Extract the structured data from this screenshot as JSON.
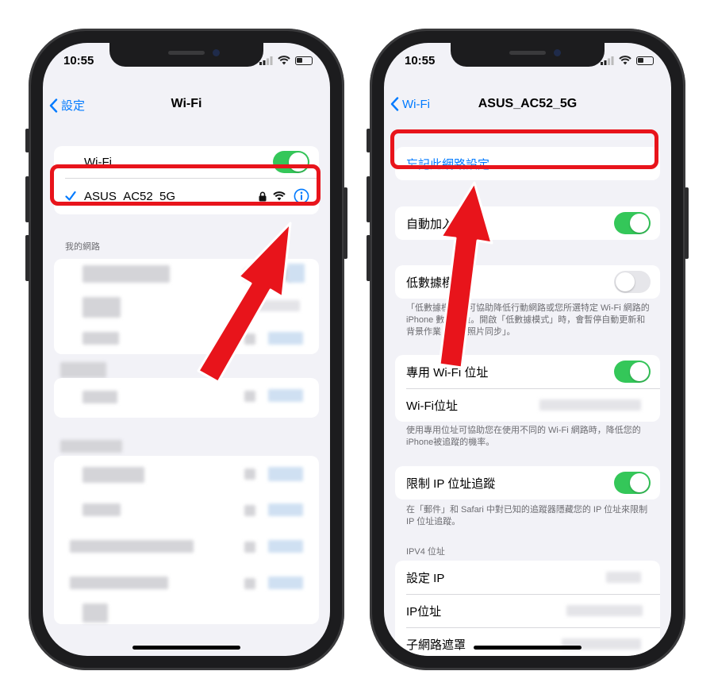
{
  "colors": {
    "accent": "#007aff",
    "toggle_on": "#34c759",
    "highlight": "#e8141b"
  },
  "left_phone": {
    "status_time": "10:55",
    "nav": {
      "back_label": "設定",
      "title": "Wi-Fi"
    },
    "wifi_row": {
      "label": "Wi-Fi",
      "toggle_on": true
    },
    "connected_network": {
      "name": "ASUS_AC52_5G",
      "icons": [
        "checkmark-icon",
        "lock-icon",
        "wifi-icon",
        "info-icon"
      ]
    },
    "my_networks_header": "我的網路"
  },
  "right_phone": {
    "status_time": "10:55",
    "nav": {
      "back_label": "Wi-Fi",
      "title": "ASUS_AC52_5G"
    },
    "forget_label": "忘記此網路設定",
    "auto_join": {
      "label": "自動加入",
      "toggle_on": true
    },
    "low_data": {
      "label": "低數據模式",
      "toggle_on": false,
      "footnote": "「低數據模式」可協助降低行動網路或您所選特定 Wi-Fi 網路的 iPhone 數據用量。開啟「低數據模式」時，會暫停自動更新和背景作業，如「照片同步」。"
    },
    "private_address": {
      "label": "專用 Wi-Fi 位址",
      "toggle_on": true,
      "wifi_address_label": "Wi-Fi位址",
      "footnote": "使用專用位址可協助您在使用不同的 Wi-Fi 網路時，降低您的iPhone被追蹤的機率。"
    },
    "limit_ip": {
      "label": "限制 IP 位址追蹤",
      "toggle_on": true,
      "footnote": "在「郵件」和 Safari 中對已知的追蹤器隱藏您的 IP 位址來限制 IP 位址追蹤。"
    },
    "ipv4": {
      "header": "IPV4 位址",
      "rows": [
        "設定 IP",
        "IP位址",
        "子網路遮罩"
      ]
    }
  }
}
